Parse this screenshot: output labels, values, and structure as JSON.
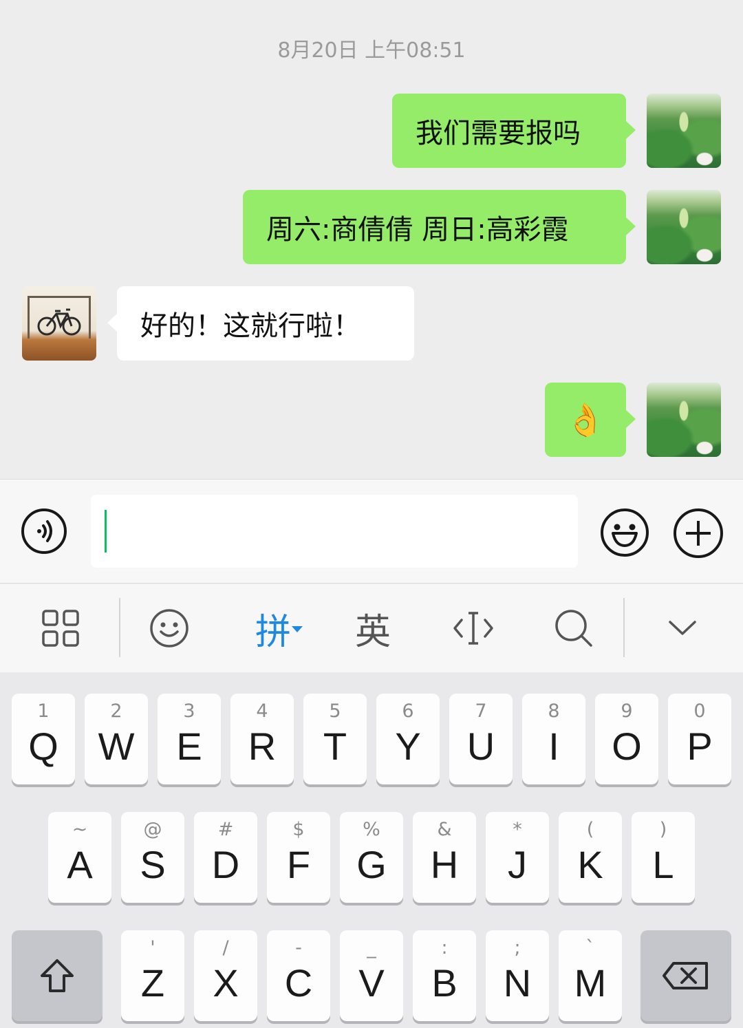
{
  "chat": {
    "timestamp": "8月20日 上午08:51",
    "messages": [
      {
        "side": "out",
        "text": "我们需要报吗"
      },
      {
        "side": "out",
        "text": "周六:商倩倩 周日:高彩霞"
      },
      {
        "side": "in",
        "text": "好的！这就行啦！"
      },
      {
        "side": "out",
        "text": "👌"
      }
    ]
  },
  "input_bar": {
    "voice_icon": "voice-icon",
    "emoji_icon": "emoji-icon",
    "plus_icon": "plus-icon",
    "value": ""
  },
  "ime_toolbar": {
    "items": [
      {
        "icon": "grid-icon"
      },
      {
        "icon": "smiley-icon"
      },
      {
        "label": "拼"
      },
      {
        "label": "英"
      },
      {
        "icon": "cursor-icon"
      },
      {
        "icon": "search-icon"
      },
      {
        "icon": "chevron-down-icon"
      }
    ]
  },
  "keyboard": {
    "row1": [
      {
        "sub": "1",
        "main": "Q"
      },
      {
        "sub": "2",
        "main": "W"
      },
      {
        "sub": "3",
        "main": "E"
      },
      {
        "sub": "4",
        "main": "R"
      },
      {
        "sub": "5",
        "main": "T"
      },
      {
        "sub": "6",
        "main": "Y"
      },
      {
        "sub": "7",
        "main": "U"
      },
      {
        "sub": "8",
        "main": "I"
      },
      {
        "sub": "9",
        "main": "O"
      },
      {
        "sub": "0",
        "main": "P"
      }
    ],
    "row2": [
      {
        "sub": "~",
        "main": "A"
      },
      {
        "sub": "@",
        "main": "S"
      },
      {
        "sub": "#",
        "main": "D"
      },
      {
        "sub": "$",
        "main": "F"
      },
      {
        "sub": "%",
        "main": "G"
      },
      {
        "sub": "&",
        "main": "H"
      },
      {
        "sub": "*",
        "main": "J"
      },
      {
        "sub": "(",
        "main": "K"
      },
      {
        "sub": ")",
        "main": "L"
      }
    ],
    "row3": [
      {
        "sub": "'",
        "main": "Z"
      },
      {
        "sub": "/",
        "main": "X"
      },
      {
        "sub": "-",
        "main": "C"
      },
      {
        "sub": "_",
        "main": "V"
      },
      {
        "sub": ":",
        "main": "B"
      },
      {
        "sub": ";",
        "main": "N"
      },
      {
        "sub": "`",
        "main": "M"
      }
    ],
    "shift_icon": "shift-icon",
    "backspace_icon": "backspace-icon"
  }
}
